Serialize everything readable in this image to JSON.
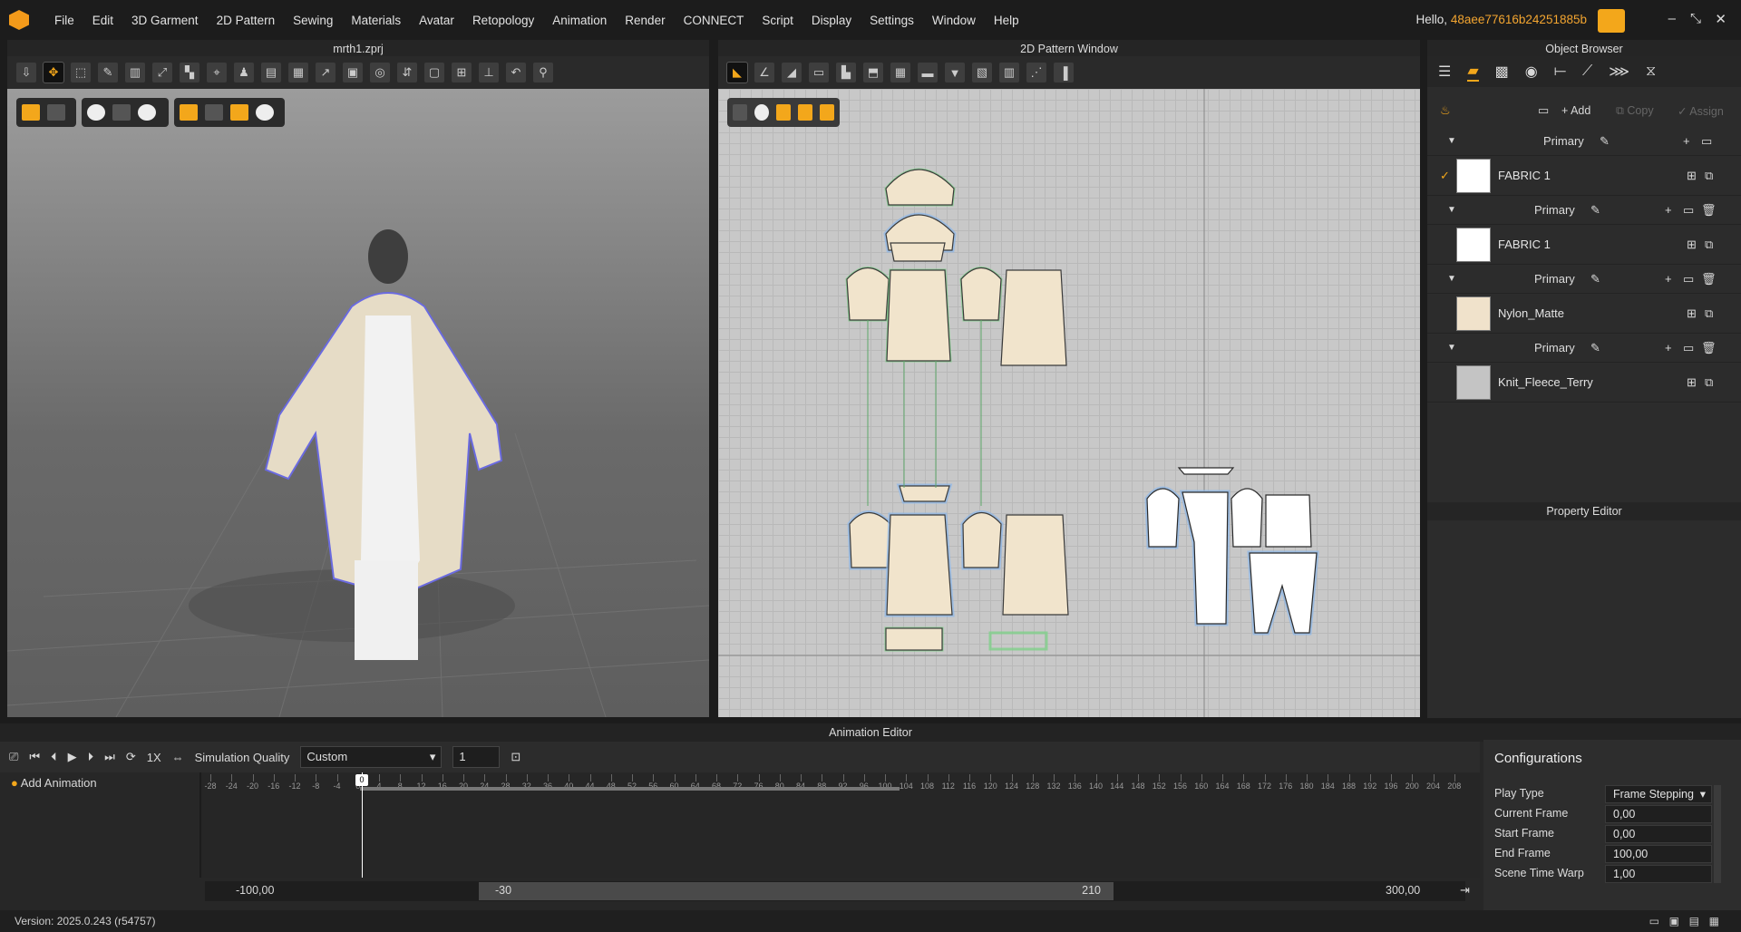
{
  "menu": {
    "items": [
      "File",
      "Edit",
      "3D Garment",
      "2D Pattern",
      "Sewing",
      "Materials",
      "Avatar",
      "Retopology",
      "Animation",
      "Render",
      "CONNECT",
      "Script",
      "Display",
      "Settings",
      "Window",
      "Help"
    ],
    "hello": "Hello,",
    "username": "48aee77616b24251885b"
  },
  "viewport3d": {
    "title": "mrth1.zprj"
  },
  "pattern_window": {
    "title": "2D Pattern Window"
  },
  "object_browser": {
    "title": "Object Browser",
    "add_label": "Add",
    "copy_label": "Copy",
    "assign_label": "Assign",
    "fabrics": [
      {
        "group": "Primary",
        "name": "FABRIC 1",
        "swatch": "#ffffff",
        "checked": true
      },
      {
        "group": "Primary",
        "name": "FABRIC 1",
        "swatch": "#ffffff",
        "checked": false
      },
      {
        "group": "Primary",
        "name": "Nylon_Matte",
        "swatch": "#f0e2cb",
        "checked": false
      },
      {
        "group": "Primary",
        "name": "Knit_Fleece_Terry",
        "swatch": "#c4c4c4",
        "checked": false
      }
    ]
  },
  "property_editor": {
    "title": "Property Editor"
  },
  "animation_editor": {
    "title": "Animation Editor",
    "speed": "1X",
    "sim_quality_label": "Simulation Quality",
    "sim_quality_value": "Custom",
    "step_value": "1",
    "add_animation": "Add Animation",
    "range_min": "-100,00",
    "range_start": "-30",
    "range_end": "210",
    "range_max": "300,00",
    "current_marker": "0",
    "ruler_labels": [
      "-28",
      "-24",
      "-20",
      "-16",
      "-12",
      "-8",
      "-4",
      "0",
      "4",
      "8",
      "12",
      "16",
      "20",
      "24",
      "28",
      "32",
      "36",
      "40",
      "44",
      "48",
      "52",
      "56",
      "60",
      "64",
      "68",
      "72",
      "76",
      "80",
      "84",
      "88",
      "92",
      "96",
      "100",
      "104",
      "108",
      "112",
      "116",
      "120",
      "124",
      "128",
      "132",
      "136",
      "140",
      "144",
      "148",
      "152",
      "156",
      "160",
      "164",
      "168",
      "172",
      "176",
      "180",
      "184",
      "188",
      "192",
      "196",
      "200",
      "204",
      "208"
    ]
  },
  "configurations": {
    "title": "Configurations",
    "rows": [
      {
        "label": "Play Type",
        "value": "Frame Stepping"
      },
      {
        "label": "Current Frame",
        "value": "0,00"
      },
      {
        "label": "Start Frame",
        "value": "0,00"
      },
      {
        "label": "End Frame",
        "value": "100,00"
      },
      {
        "label": "Scene Time Warp",
        "value": "1,00"
      }
    ]
  },
  "status": {
    "version": "Version: 2025.0.243 (r54757)"
  },
  "colors": {
    "accent": "#f3a71b",
    "selection_outline": "#8fb8e8",
    "seam": "#7fd08a"
  }
}
